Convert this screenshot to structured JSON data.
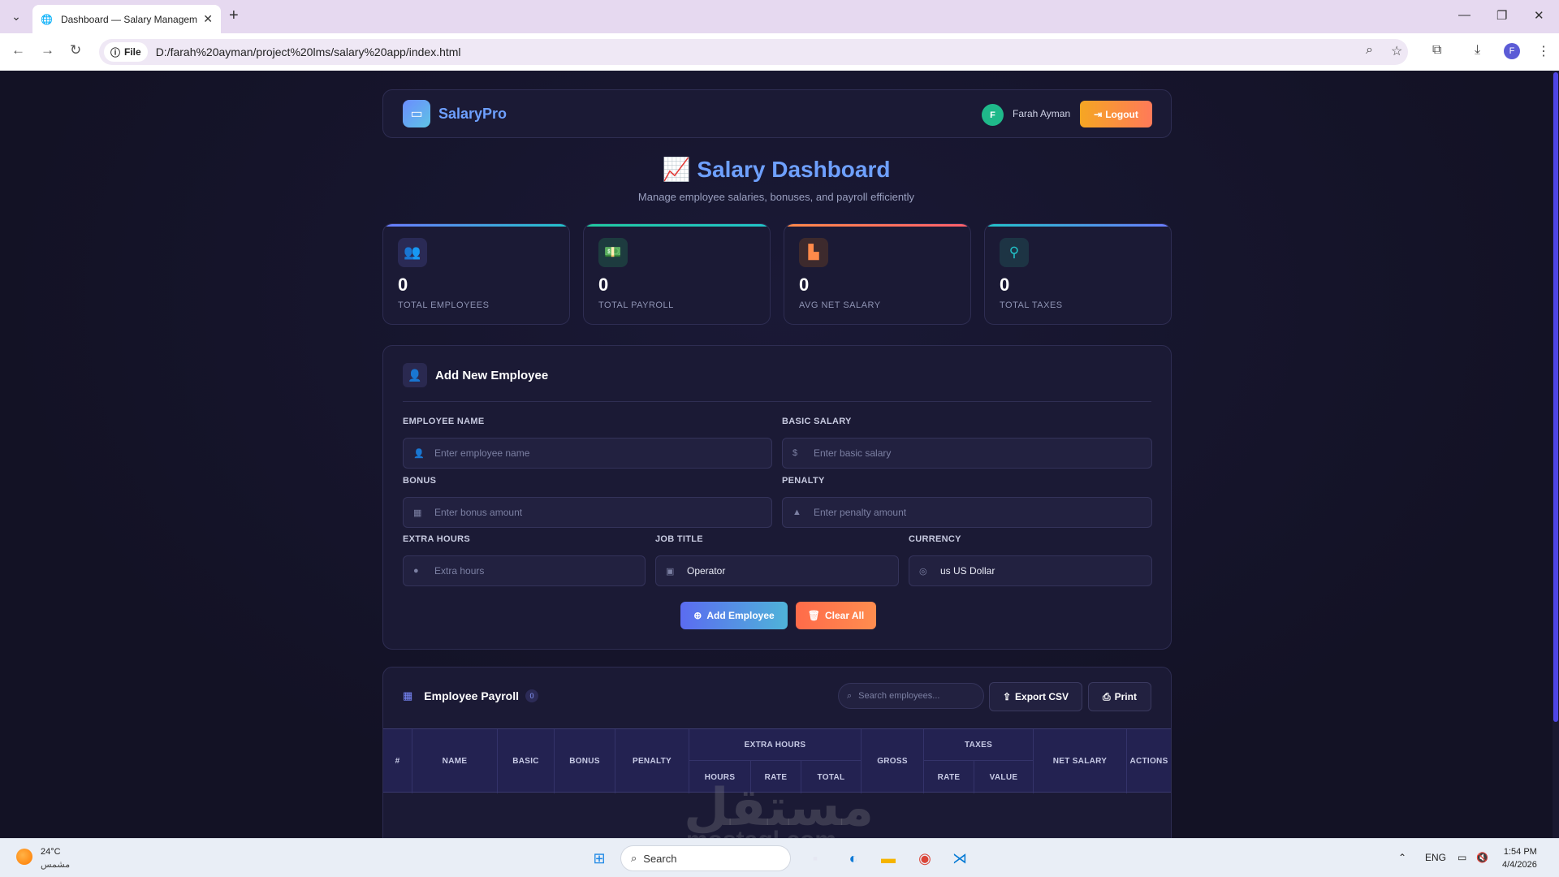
{
  "browser": {
    "tab_title": "Dashboard — Salary Managem",
    "file_chip": "File",
    "url": "D:/farah%20ayman/project%20lms/salary%20app/index.html"
  },
  "header": {
    "brand": "SalaryPro",
    "user_initial": "F",
    "user_name": "Farah Ayman",
    "logout_label": "Logout"
  },
  "page": {
    "title": "Salary Dashboard",
    "subtitle": "Manage employee salaries, bonuses, and payroll efficiently"
  },
  "stats": [
    {
      "value": "0",
      "label": "TOTAL EMPLOYEES",
      "icon": "users-icon",
      "accent": "#6b7cff"
    },
    {
      "value": "0",
      "label": "TOTAL PAYROLL",
      "icon": "money-icon",
      "accent": "#22c9a0"
    },
    {
      "value": "0",
      "label": "AVG NET SALARY",
      "icon": "chart-icon",
      "accent": "#ff8a4a"
    },
    {
      "value": "0",
      "label": "TOTAL TAXES",
      "icon": "hand-coin-icon",
      "accent": "#22c3c9"
    }
  ],
  "form": {
    "title": "Add New Employee",
    "name_label": "EMPLOYEE NAME",
    "name_placeholder": "Enter employee name",
    "salary_label": "BASIC SALARY",
    "salary_placeholder": "Enter basic salary",
    "bonus_label": "BONUS",
    "bonus_placeholder": "Enter bonus amount",
    "penalty_label": "PENALTY",
    "penalty_placeholder": "Enter penalty amount",
    "extra_label": "EXTRA HOURS",
    "extra_placeholder": "Extra hours",
    "job_label": "JOB TITLE",
    "job_value": "Operator",
    "currency_label": "CURRENCY",
    "currency_value": "us US Dollar",
    "add_label": "Add Employee",
    "clear_label": "Clear All"
  },
  "table": {
    "title": "Employee Payroll",
    "count": "0",
    "search_placeholder": "Search employees...",
    "export_label": "Export CSV",
    "print_label": "Print",
    "columns": {
      "index": "#",
      "name": "NAME",
      "basic": "BASIC",
      "bonus": "BONUS",
      "penalty": "PENALTY",
      "extra_hours": "EXTRA HOURS",
      "hours": "HOURS",
      "rate": "RATE",
      "total": "TOTAL",
      "gross": "GROSS",
      "taxes": "TAXES",
      "tax_rate": "RATE",
      "tax_value": "VALUE",
      "net_salary": "NET SALARY",
      "actions": "ACTIONS"
    }
  },
  "taskbar": {
    "temperature": "24°C",
    "condition": "مشمس",
    "search_label": "Search",
    "language": "ENG",
    "time": "1:54 PM",
    "date": "4/4/2026"
  },
  "watermark": {
    "arabic": "مستقل",
    "latin": "mostaql.com"
  }
}
